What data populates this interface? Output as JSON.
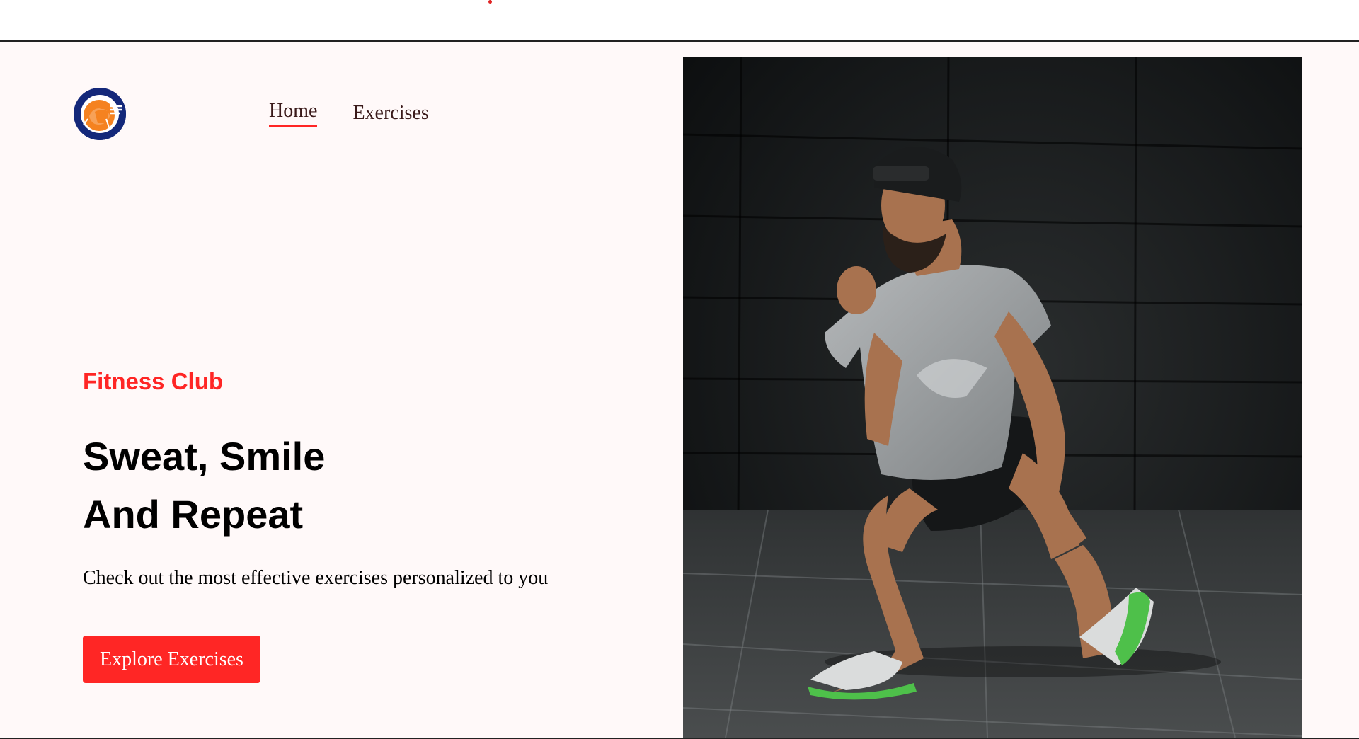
{
  "header": {
    "accent_color": "#ff2625"
  },
  "nav": {
    "logo_icon": "gym-logo-icon",
    "items": [
      {
        "label": "Home",
        "active": true
      },
      {
        "label": "Exercises",
        "active": false
      }
    ]
  },
  "hero": {
    "eyebrow": "Fitness Club",
    "headline_line1": "Sweat, Smile",
    "headline_line2": "And Repeat",
    "subtext": "Check out the most effective exercises personalized to you",
    "cta_label": "Explore Exercises",
    "image_icon": "athlete-lunge-photo"
  },
  "colors": {
    "page_background": "#fff9f9",
    "accent": "#ff2625",
    "text": "#000000",
    "nav_text": "#3a1a1a",
    "logo_blue": "#14287a",
    "logo_orange": "#f58220"
  }
}
